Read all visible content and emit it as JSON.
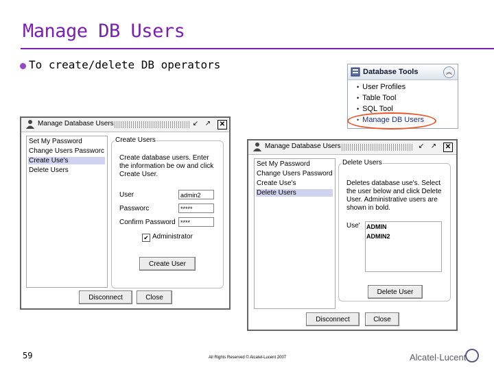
{
  "slide": {
    "title": "Manage DB Users",
    "bullet": "To create/delete DB operators",
    "page_number": "59",
    "copyright": "All Rights Reserved © Alcatel-Lucent 2007",
    "logo_text": "Alcatel·Lucent",
    "accent_color": "#7a1fb4"
  },
  "db_tools": {
    "title": "Database Tools",
    "items": [
      {
        "label": "User Profiles"
      },
      {
        "label": "Table Tool"
      },
      {
        "label": "SQL Tool"
      },
      {
        "label": "Manage DB Users",
        "highlighted": true
      }
    ]
  },
  "create_window": {
    "title": "Manage Database Users",
    "menu": [
      "Set My Password",
      "Change Users Passworc",
      "Create Use's",
      "Delete Users"
    ],
    "selected_menu_index": 2,
    "group_title": "Create Users",
    "description": "Create database users. Enter the information be ow and click Create User.",
    "fields": [
      {
        "label": "User",
        "value": "admin2"
      },
      {
        "label": "Passworc",
        "value": "*****"
      },
      {
        "label": "Confirm Password",
        "value": "****"
      }
    ],
    "checkbox_label": "Administrator",
    "checkbox_checked": true,
    "create_button": "Create User",
    "disconnect_button": "Disconnect",
    "close_button": "Close"
  },
  "delete_window": {
    "title": "Manage Database Users",
    "menu": [
      "Set My Password",
      "Change Users Password",
      "Create Use's",
      "Delete Users"
    ],
    "selected_menu_index": 3,
    "group_title": "Delete Users",
    "description": "Deletes database use's. Select the user below and click Delete User. Administrative users are shown in bold.",
    "users_label": "Use'",
    "users": [
      "ADMIN",
      "ADMIN2"
    ],
    "delete_button": "Delete User",
    "disconnect_button": "Disconnect",
    "close_button": "Close"
  }
}
